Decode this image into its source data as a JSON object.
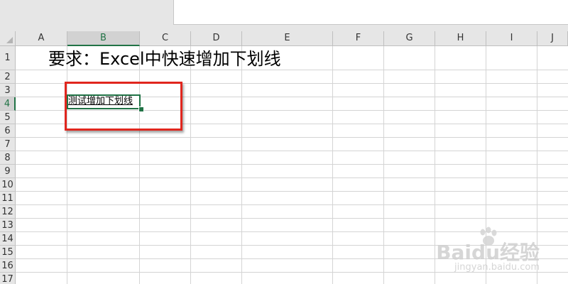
{
  "columns": [
    "A",
    "B",
    "C",
    "D",
    "E",
    "F",
    "G",
    "H",
    "I",
    "J"
  ],
  "selected_column": "B",
  "rows": [
    "1",
    "2",
    "3",
    "4",
    "5",
    "6",
    "7",
    "8",
    "9",
    "10",
    "11",
    "12",
    "13",
    "14",
    "15",
    "16",
    "17"
  ],
  "selected_row": "4",
  "cells": {
    "A1": "要求：Excel中快速增加下划线",
    "B4": "测试增加下划线"
  },
  "colors": {
    "accent": "#217346",
    "highlight": "#e0261e",
    "grid": "#d4d4d4",
    "header_bg": "#e6e6e6"
  },
  "watermark": {
    "logo": "Baidu经验",
    "url": "jingyan.baidu.com"
  }
}
